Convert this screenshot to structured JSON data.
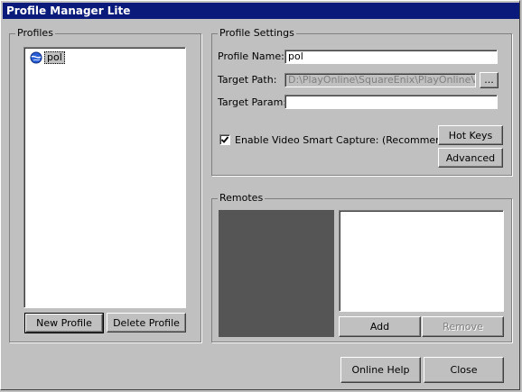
{
  "window": {
    "title": "Profile Manager Lite"
  },
  "profiles": {
    "group_label": "Profiles",
    "items": [
      {
        "label": "pol",
        "icon": "globe-icon",
        "selected": true
      }
    ],
    "new_button": "New Profile",
    "delete_button": "Delete Profile"
  },
  "settings": {
    "group_label": "Profile Settings",
    "name_label": "Profile Name:",
    "name_value": "pol",
    "path_label": "Target Path:",
    "path_value": "D:\\PlayOnline\\SquareEnix\\PlayOnlineViewer",
    "browse_button": "...",
    "param_label": "Target Param:",
    "param_value": "",
    "capture_label": "Enable Video Smart Capture: (Recommended)",
    "capture_checked": true,
    "hotkeys_button": "Hot Keys",
    "advanced_button": "Advanced"
  },
  "remotes": {
    "group_label": "Remotes",
    "add_button": "Add",
    "remove_button": "Remove"
  },
  "footer": {
    "help_button": "Online Help",
    "close_button": "Close"
  },
  "colors": {
    "titlebar": "#0a1a7a",
    "face": "#c0c0c0",
    "preview": "#555555"
  }
}
